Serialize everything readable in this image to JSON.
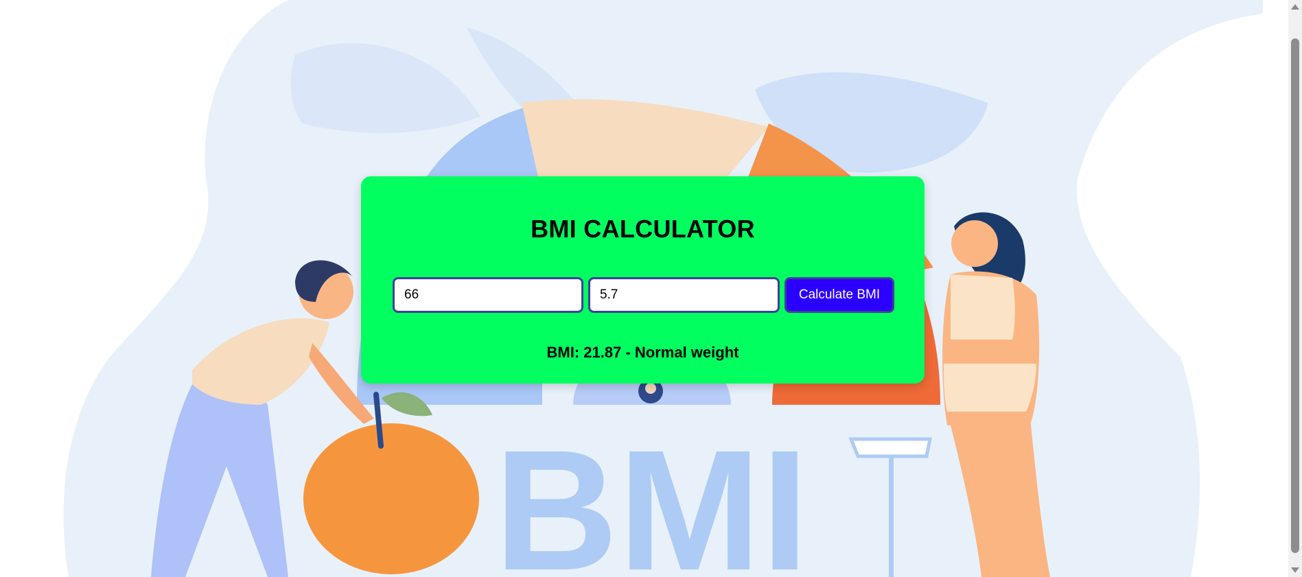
{
  "app": {
    "title": "BMI CALCULATOR"
  },
  "form": {
    "weight_value": "66",
    "height_value": "5.7",
    "calculate_label": "Calculate BMI"
  },
  "result": {
    "text": "BMI: 21.87 - Normal weight"
  },
  "background": {
    "banner_text": "BMI"
  },
  "colors": {
    "card_background": "#00ff5f",
    "button_background": "#2b00ff",
    "field_border": "#3f3f9a",
    "page_blob": "#e8f1fa",
    "banner_letters": "#aecbf5"
  },
  "icons": {
    "scroll_up": "triangle-up-icon",
    "scroll_down": "triangle-down-icon"
  }
}
